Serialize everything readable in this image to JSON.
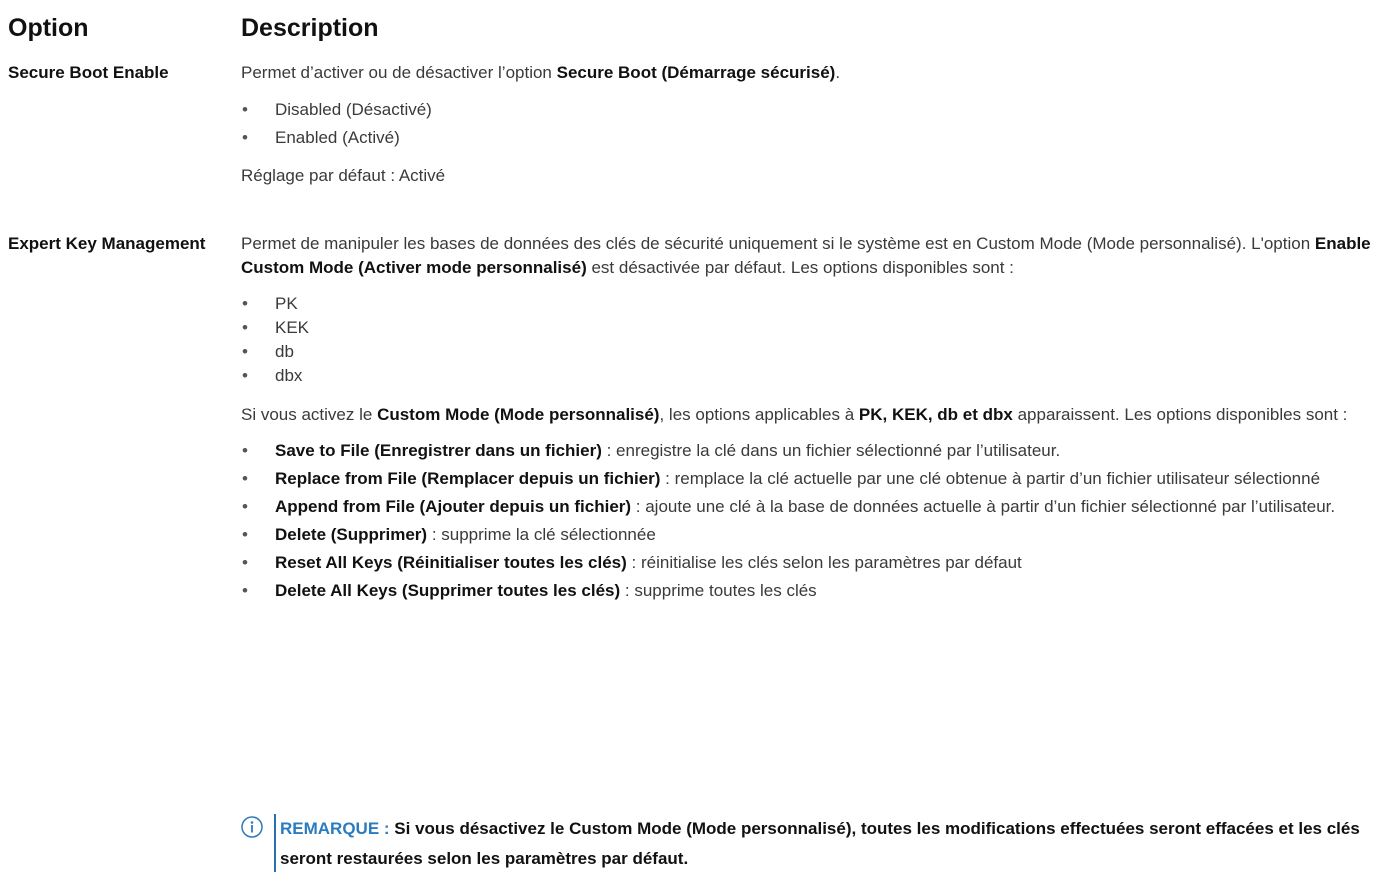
{
  "header": {
    "option": "Option",
    "description": "Description"
  },
  "rows": [
    {
      "name": "Secure Boot Enable",
      "intro_pre": "Permet d’activer ou de désactiver l’option ",
      "intro_bold": "Secure Boot (Démarrage sécurisé)",
      "intro_post": ".",
      "items": [
        "Disabled (Désactivé)",
        "Enabled (Activé)"
      ],
      "default": "Réglage par défaut : Activé"
    },
    {
      "name": "Expert Key Management",
      "intro_pre": "Permet de manipuler les bases de données des clés de sécurité uniquement si le système est en Custom Mode (Mode personnalisé). L'option ",
      "intro_bold": "Enable Custom Mode (Activer mode personnalisé)",
      "intro_post": " est désactivée par défaut. Les options disponibles sont :",
      "items": [
        "PK",
        "KEK",
        "db",
        "dbx"
      ],
      "custom_pre": "Si vous activez le ",
      "custom_bold1": "Custom Mode (Mode personnalisé)",
      "custom_mid": ", les options applicables à ",
      "custom_bold2": "PK, KEK, db et dbx",
      "custom_post": " apparaissent. Les options disponibles sont :",
      "actions": [
        {
          "label": "Save to File (Enregistrer dans un fichier)",
          "text": " : enregistre la clé dans un fichier sélectionné par l’utilisateur."
        },
        {
          "label": "Replace from File (Remplacer depuis un fichier)",
          "text": " : remplace la clé actuelle par une clé obtenue à partir d’un fichier utilisateur sélectionné"
        },
        {
          "label": "Append from File (Ajouter depuis un fichier)",
          "text": " : ajoute une clé à la base de données actuelle à partir d’un fichier sélectionné par l’utilisateur."
        },
        {
          "label": "Delete (Supprimer)",
          "text": " : supprime la clé sélectionnée"
        },
        {
          "label": "Reset All Keys (Réinitialiser toutes les clés)",
          "text": " : réinitialise les clés selon les paramètres par défaut"
        },
        {
          "label": "Delete All Keys (Supprimer toutes les clés)",
          "text": " : supprime toutes les clés"
        }
      ]
    }
  ],
  "note": {
    "label": "REMARQUE : ",
    "text": "Si vous désactivez le Custom Mode (Mode personnalisé), toutes les modifications effectuées seront effacées et les clés seront restaurées selon les paramètres par défaut."
  },
  "icons": {
    "bullet": "•",
    "note_icon": "info-icon"
  },
  "colors": {
    "note_accent": "#2b7bbf",
    "note_bar": "#2b6fad"
  }
}
